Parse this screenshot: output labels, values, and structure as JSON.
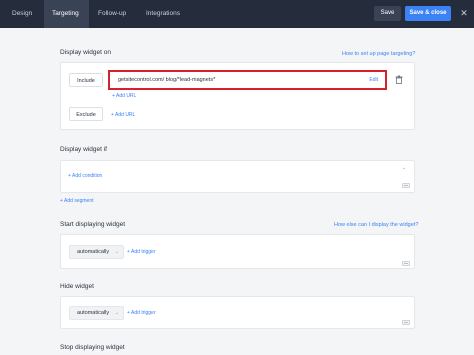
{
  "tabs": [
    "Design",
    "Targeting",
    "Follow-up",
    "Integrations"
  ],
  "actions": {
    "save": "Save",
    "save_close": "Save & close",
    "close_glyph": "✕"
  },
  "display_on": {
    "title": "Display widget on",
    "help": "How to set up page targeting?",
    "include_label": "Include",
    "url": "getsitecontrol.com/ blog/*lead-magnets*",
    "edit": "Edit",
    "add_url_include": "+ Add URL",
    "exclude_label": "Exclude",
    "add_url_exclude": "+ Add URL"
  },
  "display_if": {
    "title": "Display widget if",
    "add_condition": "+ Add condition",
    "add_segment": "+ Add segment"
  },
  "start": {
    "title": "Start displaying widget",
    "help": "How else can I display the widget?",
    "select_value": "automatically",
    "add_trigger": "+ Add trigger"
  },
  "hide": {
    "title": "Hide widget",
    "select_value": "automatically",
    "add_trigger": "+ Add trigger"
  },
  "stop": {
    "title": "Stop displaying widget"
  },
  "colors": {
    "topbar": "#252c3b",
    "accent": "#3b82f6",
    "highlight": "#d4202f"
  }
}
